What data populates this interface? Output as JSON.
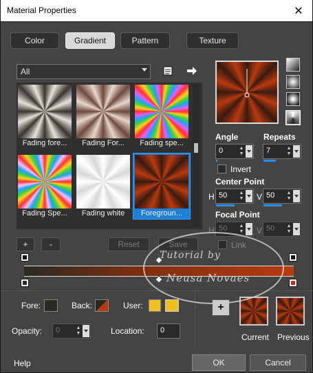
{
  "window": {
    "title": "Material Properties"
  },
  "tabs": [
    {
      "label": "Color"
    },
    {
      "label": "Gradient"
    },
    {
      "label": "Pattern"
    },
    {
      "label": "Texture"
    }
  ],
  "category_select": {
    "value": "All"
  },
  "gradients": [
    {
      "label": "Fading fore..."
    },
    {
      "label": "Fading For..."
    },
    {
      "label": "Fading spe..."
    },
    {
      "label": "Fading Spe..."
    },
    {
      "label": "Fading white"
    },
    {
      "label": "Foregroun..."
    }
  ],
  "buttons": {
    "add": "+",
    "remove": "-",
    "reset": "Reset",
    "save": "Save"
  },
  "angle": {
    "label": "Angle",
    "value": "0"
  },
  "repeats": {
    "label": "Repeats",
    "value": "7"
  },
  "invert": {
    "label": "Invert"
  },
  "center_point": {
    "label": "Center Point",
    "h_label": "H",
    "h": "50",
    "v_label": "V",
    "v": "50"
  },
  "focal_point": {
    "label": "Focal Point",
    "h_label": "H",
    "h": "50",
    "v_label": "V",
    "v": "50"
  },
  "link": {
    "label": "Link"
  },
  "fore": {
    "label": "Fore:"
  },
  "back": {
    "label": "Back:"
  },
  "user": {
    "label": "User:"
  },
  "opacity": {
    "label": "Opacity:",
    "value": "0"
  },
  "location": {
    "label": "Location:",
    "value": "0"
  },
  "add_button": "+",
  "current": {
    "label": "Current"
  },
  "previous": {
    "label": "Previous"
  },
  "footer": {
    "help": "Help",
    "ok": "OK",
    "cancel": "Cancel"
  },
  "watermark": {
    "line1": "Tutorial by",
    "line2": "Neusa Novaes"
  },
  "colors": {
    "foreground": "#2a2a24",
    "background": "#b83a10",
    "user": "#f0c020",
    "selection": "#1e7fd8"
  }
}
